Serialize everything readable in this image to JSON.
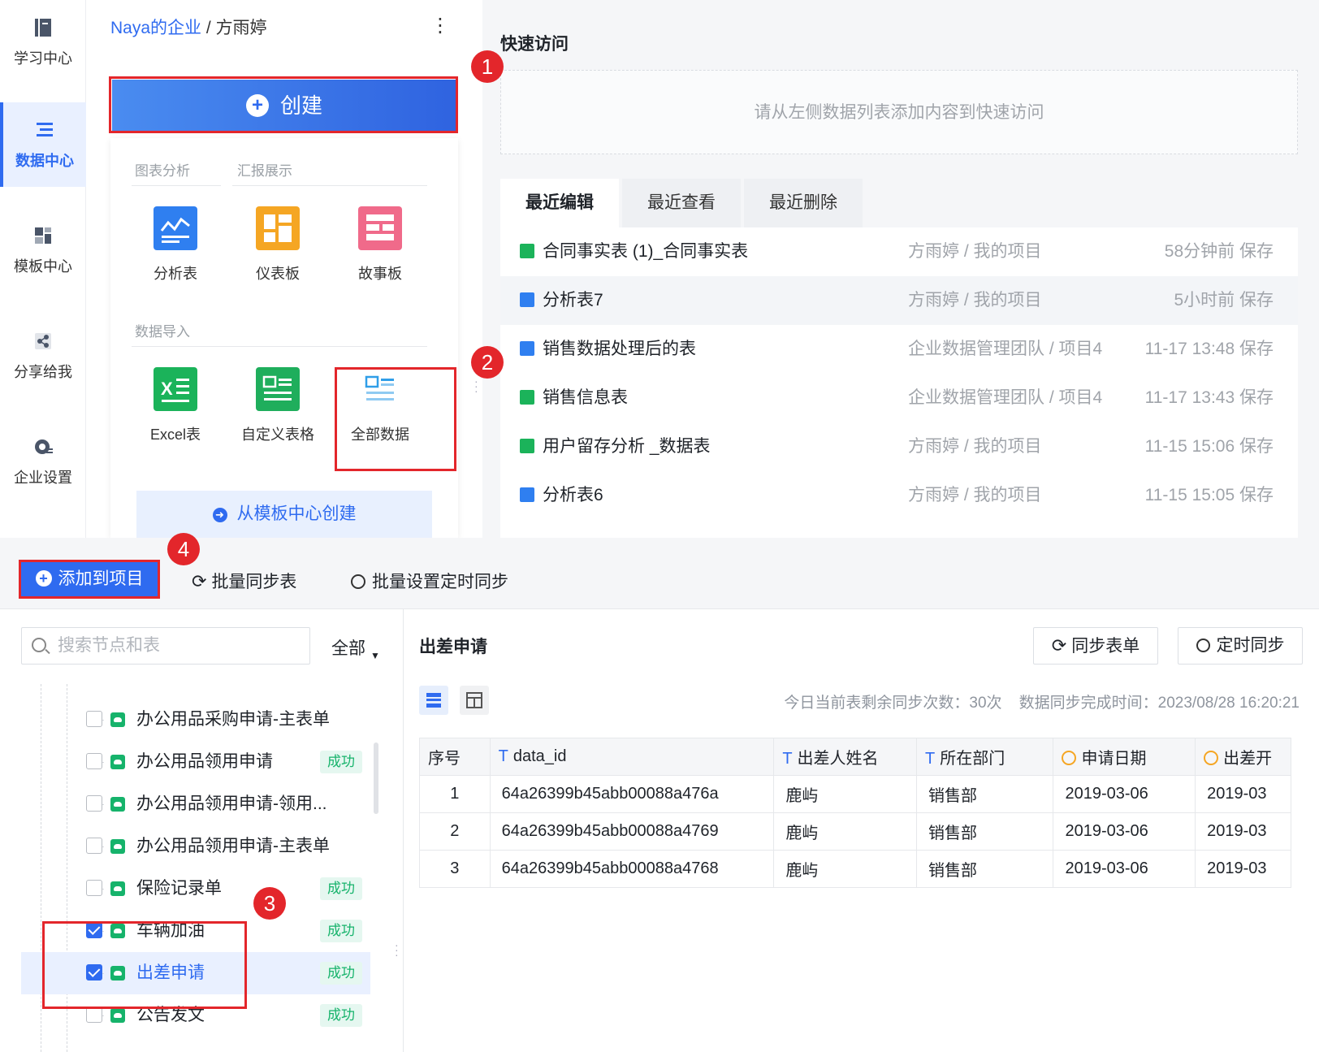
{
  "sidebar": {
    "items": [
      {
        "label": "学习中心",
        "icon": "book-icon"
      },
      {
        "label": "数据中心",
        "icon": "data-center-icon",
        "active": true
      },
      {
        "label": "模板中心",
        "icon": "template-icon"
      },
      {
        "label": "分享给我",
        "icon": "share-icon"
      },
      {
        "label": "企业设置",
        "icon": "settings-icon"
      }
    ]
  },
  "breadcrumb": {
    "org": "Naya的企业",
    "sep": "/",
    "user": "方雨婷"
  },
  "create": {
    "label": "创建",
    "sections": {
      "chart": "图表分析",
      "report": "汇报展示",
      "import": "数据导入"
    },
    "tiles": [
      {
        "label": "分析表",
        "color": "#2f7ff0"
      },
      {
        "label": "仪表板",
        "color": "#f5a623"
      },
      {
        "label": "故事板",
        "color": "#f06a8a"
      },
      {
        "label": "Excel表",
        "color": "#1bb35a"
      },
      {
        "label": "自定义表格",
        "color": "#1fae5c"
      },
      {
        "label": "全部数据",
        "color": "#2f9ee8"
      }
    ],
    "from_template": "从模板中心创建"
  },
  "quick_access": {
    "title": "快速访问",
    "empty": "请从左侧数据列表添加内容到快速访问"
  },
  "tabs": [
    "最近编辑",
    "最近查看",
    "最近删除"
  ],
  "recent": [
    {
      "name": "合同事实表 (1)_合同事实表",
      "path": "方雨婷 / 我的项目",
      "time": "58分钟前 保存",
      "kind": "table"
    },
    {
      "name": "分析表7",
      "path": "方雨婷 / 我的项目",
      "time": "5小时前 保存",
      "kind": "chart"
    },
    {
      "name": "销售数据处理后的表",
      "path": "企业数据管理团队 / 项目4",
      "time": "11-17 13:48 保存",
      "kind": "chart"
    },
    {
      "name": "销售信息表",
      "path": "企业数据管理团队 / 项目4",
      "time": "11-17 13:43 保存",
      "kind": "table"
    },
    {
      "name": "用户留存分析 _数据表",
      "path": "方雨婷 / 我的项目",
      "time": "11-15 15:06 保存",
      "kind": "table"
    },
    {
      "name": "分析表6",
      "path": "方雨婷 / 我的项目",
      "time": "11-15 15:05 保存",
      "kind": "chart"
    }
  ],
  "steps": [
    "1",
    "2",
    "3",
    "4"
  ],
  "toolbar": {
    "add": "添加到项目",
    "batch_sync": "批量同步表",
    "batch_timer": "批量设置定时同步"
  },
  "search": {
    "placeholder": "搜索节点和表",
    "filter": "全部"
  },
  "tree": [
    {
      "name": "办公用品采购申请-主表单",
      "status": "",
      "checked": false
    },
    {
      "name": "办公用品领用申请",
      "status": "成功",
      "checked": false
    },
    {
      "name": "办公用品领用申请-领用...",
      "status": "",
      "checked": false
    },
    {
      "name": "办公用品领用申请-主表单",
      "status": "",
      "checked": false
    },
    {
      "name": "保险记录单",
      "status": "成功",
      "checked": false
    },
    {
      "name": "车辆加油",
      "status": "成功",
      "checked": true
    },
    {
      "name": "出差申请",
      "status": "成功",
      "checked": true,
      "selected": true
    },
    {
      "name": "公告发文",
      "status": "成功",
      "checked": false
    }
  ],
  "detail": {
    "title": "出差申请",
    "sync_btn": "同步表单",
    "timer_btn": "定时同步",
    "remaining": "今日当前表剩余同步次数：30次",
    "completed": "数据同步完成时间：2023/08/28 16:20:21",
    "columns": [
      "序号",
      "data_id",
      "出差人姓名",
      "所在部门",
      "申请日期",
      "出差开"
    ],
    "rows": [
      [
        "1",
        "64a26399b45abb00088a476a",
        "鹿屿",
        "销售部",
        "2019-03-06",
        "2019-03"
      ],
      [
        "2",
        "64a26399b45abb00088a4769",
        "鹿屿",
        "销售部",
        "2019-03-06",
        "2019-03"
      ],
      [
        "3",
        "64a26399b45abb00088a4768",
        "鹿屿",
        "销售部",
        "2019-03-06",
        "2019-03"
      ]
    ]
  }
}
